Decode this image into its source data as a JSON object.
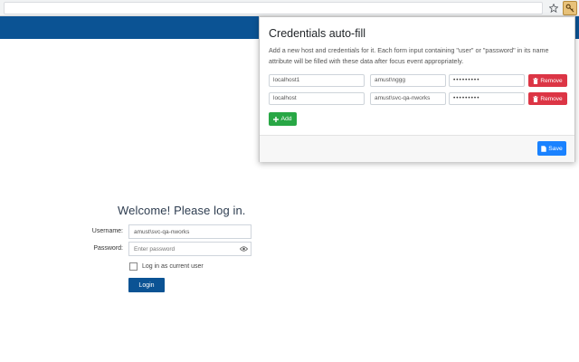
{
  "browser": {
    "star_icon": "star-icon",
    "extension_icon": "key-icon"
  },
  "login": {
    "title": "Welcome! Please log in.",
    "username_label": "Username:",
    "username_value": "amust\\svc-qa-nworks",
    "password_label": "Password:",
    "password_placeholder": "Enter password",
    "remember_label": "Log in as current user",
    "login_button": "Login"
  },
  "popup": {
    "title": "Credentials auto-fill",
    "description": "Add a new host and credentials for it. Each form input containing \"user\" or \"password\" in its name attribute will be filled with these data after focus event appropriately.",
    "rows": [
      {
        "host": "localhost1",
        "user": "amust\\nggg",
        "password": "•••••••••",
        "remove_label": "Remove"
      },
      {
        "host": "localhost",
        "user": "amust\\svc-qa-nworks",
        "password": "•••••••••",
        "remove_label": "Remove"
      }
    ],
    "add_label": "Add",
    "save_label": "Save"
  },
  "colors": {
    "header": "#0b5394",
    "remove": "#dc3545",
    "add": "#28a745",
    "save": "#1a82ff"
  }
}
